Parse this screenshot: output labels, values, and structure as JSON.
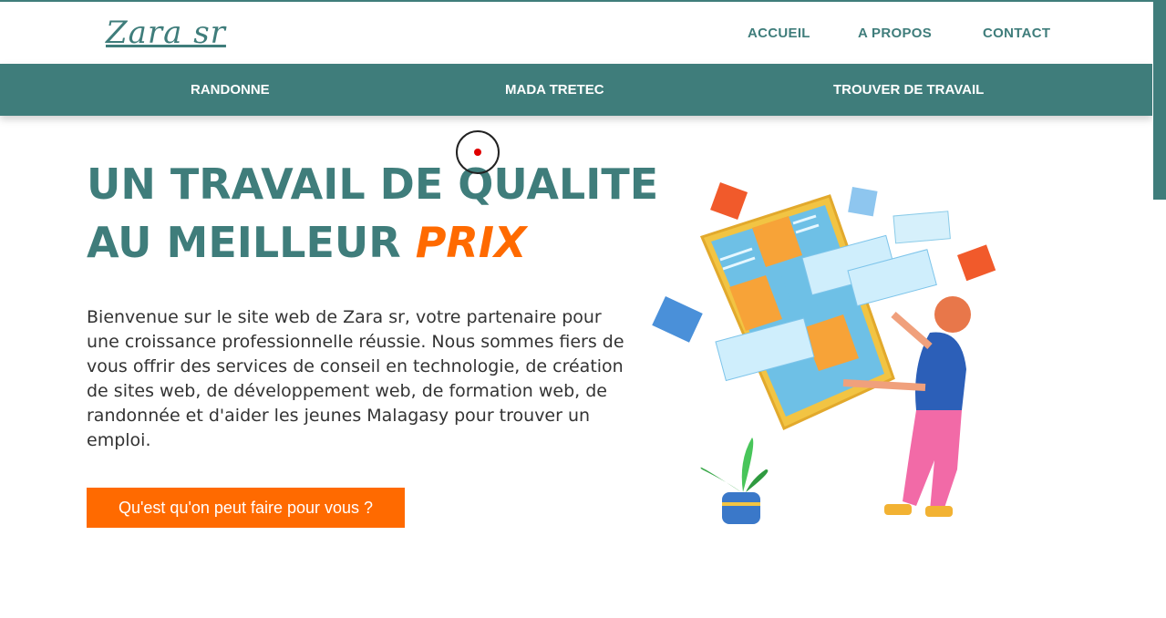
{
  "header": {
    "logo_text": "Zara sr",
    "nav": [
      "ACCUEIL",
      "A PROPOS",
      "CONTACT"
    ]
  },
  "subnav": {
    "items": [
      "RANDONNE",
      "MADA TRETEC",
      "TROUVER DE TRAVAIL"
    ]
  },
  "hero": {
    "headline_line1": "UN TRAVAIL DE QUALITE",
    "headline_line2_prefix": "AU MEILLEUR ",
    "headline_accent": "PRIX",
    "intro": "Bienvenue sur le site web de Zara sr, votre partenaire pour une croissance professionnelle réussie. Nous sommes fiers de vous offrir des services de conseil en technologie, de création de sites web, de développement web, de formation web, de randonnée et d'aider les jeunes Malagasy pour trouver un emploi.",
    "cta_label": "Qu'est qu'on peut faire pour vous ?"
  },
  "colors": {
    "brand": "#3f7d7b",
    "accent": "#ff6a00"
  }
}
